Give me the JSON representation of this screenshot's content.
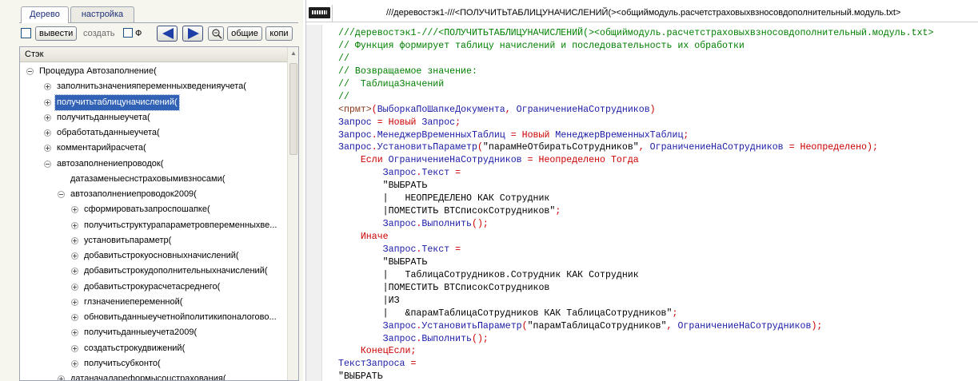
{
  "left": {
    "tabs": [
      "Дерево",
      "настройка"
    ],
    "toolbar": {
      "show_label": "вывести",
      "create_label": "создать",
      "f_label": "Ф",
      "common_label": "общие",
      "copy_label": "копи"
    },
    "tree_header": "Стэк",
    "tree_rows": [
      {
        "label": "Процедура Автозаполнение(",
        "level": 0,
        "expander": "minus",
        "selected": false
      },
      {
        "label": "заполнитьзначенияпеременныхведенияучета(",
        "level": 1,
        "expander": "plus",
        "selected": false
      },
      {
        "label": "получитьтаблицуначислений(",
        "level": 1,
        "expander": "plus",
        "selected": true
      },
      {
        "label": "получитьданныеучета(",
        "level": 1,
        "expander": "plus",
        "selected": false
      },
      {
        "label": "обработатьданныеучета(",
        "level": 1,
        "expander": "plus",
        "selected": false
      },
      {
        "label": "комментарийрасчета(",
        "level": 1,
        "expander": "plus",
        "selected": false
      },
      {
        "label": "автозаполнениепроводок(",
        "level": 1,
        "expander": "minus",
        "selected": false
      },
      {
        "label": "датазаменыеснстраховымивзносами(",
        "level": 2,
        "expander": "none",
        "selected": false
      },
      {
        "label": "автозаполнениепроводок2009(",
        "level": 2,
        "expander": "minus",
        "selected": false
      },
      {
        "label": "сформироватьзапроспошапке(",
        "level": 3,
        "expander": "plus",
        "selected": false
      },
      {
        "label": "получитьструктурапараметровпеременныхве...",
        "level": 3,
        "expander": "plus",
        "selected": false
      },
      {
        "label": "установитьпараметр(",
        "level": 3,
        "expander": "plus",
        "selected": false
      },
      {
        "label": "добавитьстрокуосновныхначислений(",
        "level": 3,
        "expander": "plus",
        "selected": false
      },
      {
        "label": "добавитьстрокудополнительныхначислений(",
        "level": 3,
        "expander": "plus",
        "selected": false
      },
      {
        "label": "добавитьстрокурасчетасреднего(",
        "level": 3,
        "expander": "plus",
        "selected": false
      },
      {
        "label": "глзначениепеременной(",
        "level": 3,
        "expander": "plus",
        "selected": false
      },
      {
        "label": "обновитьданныеучетнойполитикипоналогово...",
        "level": 3,
        "expander": "plus",
        "selected": false
      },
      {
        "label": "получитьданныеучета2009(",
        "level": 3,
        "expander": "plus",
        "selected": false
      },
      {
        "label": "создатьстрокудвижений(",
        "level": 3,
        "expander": "plus",
        "selected": false
      },
      {
        "label": "получитьсубконто(",
        "level": 3,
        "expander": "plus",
        "selected": false
      },
      {
        "label": "датаначалареформысоцстрахования(",
        "level": 2,
        "expander": "plus",
        "selected": false
      }
    ]
  },
  "right": {
    "title": "///деревостэк1-///<ПОЛУЧИТЬТАБЛИЦУНАЧИСЛЕНИЙ(><общиймодуль.расчетстраховыхвзносовдополнительный.модуль.txt>",
    "code_lines": [
      [
        {
          "t": "///деревостэк1-///<ПОЛУЧИТЬТАБЛИЦУНАЧИСЛЕНИЙ(><общиймодуль.расчетстраховыхвзносовдополнительный.модуль.txt>",
          "c": "com"
        }
      ],
      [
        {
          "t": "// Функция формирует таблицу начислений и последовательность их обработки",
          "c": "com"
        }
      ],
      [
        {
          "t": "//",
          "c": "com"
        }
      ],
      [
        {
          "t": "// Возвращаемое значение:",
          "c": "com"
        }
      ],
      [
        {
          "t": "//  ТаблицаЗначений",
          "c": "com"
        }
      ],
      [
        {
          "t": "//",
          "c": "com"
        }
      ],
      [
        {
          "t": "<прмт>",
          "c": "pp"
        },
        {
          "t": "(",
          "c": "op"
        },
        {
          "t": "ВыборкаПоШапкеДокумента",
          "c": "id"
        },
        {
          "t": ", ",
          "c": "op"
        },
        {
          "t": "ОграничениеНаСотрудников",
          "c": "id"
        },
        {
          "t": ")",
          "c": "op"
        }
      ],
      [
        {
          "t": "Запрос",
          "c": "id"
        },
        {
          "t": " = ",
          "c": "op"
        },
        {
          "t": "Новый",
          "c": "kw"
        },
        {
          "t": " Запрос",
          "c": "id"
        },
        {
          "t": ";",
          "c": "op"
        }
      ],
      [
        {
          "t": "Запрос",
          "c": "id"
        },
        {
          "t": ".",
          "c": "op"
        },
        {
          "t": "МенеджерВременныхТаблиц",
          "c": "id"
        },
        {
          "t": " = ",
          "c": "op"
        },
        {
          "t": "Новый",
          "c": "kw"
        },
        {
          "t": " МенеджерВременныхТаблиц",
          "c": "id"
        },
        {
          "t": ";",
          "c": "op"
        }
      ],
      [
        {
          "t": "Запрос",
          "c": "id"
        },
        {
          "t": ".",
          "c": "op"
        },
        {
          "t": "УстановитьПараметр",
          "c": "id"
        },
        {
          "t": "(",
          "c": "op"
        },
        {
          "t": "\"парамНеОтбиратьСотрудников\"",
          "c": "str"
        },
        {
          "t": ", ",
          "c": "op"
        },
        {
          "t": "ОграничениеНаСотрудников",
          "c": "id"
        },
        {
          "t": " = ",
          "c": "op"
        },
        {
          "t": "Неопределено",
          "c": "kw"
        },
        {
          "t": ");",
          "c": "op"
        }
      ],
      [
        {
          "t": "    "
        },
        {
          "t": "Если",
          "c": "kw"
        },
        {
          "t": " ОграничениеНаСотрудников",
          "c": "id"
        },
        {
          "t": " = ",
          "c": "op"
        },
        {
          "t": "Неопределено",
          "c": "kw"
        },
        {
          "t": " ",
          "c": "op"
        },
        {
          "t": "Тогда",
          "c": "kw"
        }
      ],
      [
        {
          "t": "        "
        },
        {
          "t": "Запрос",
          "c": "id"
        },
        {
          "t": ".",
          "c": "op"
        },
        {
          "t": "Текст",
          "c": "id"
        },
        {
          "t": " =",
          "c": "op"
        }
      ],
      [
        {
          "t": "        "
        },
        {
          "t": "\"ВЫБРАТЬ",
          "c": "str"
        }
      ],
      [
        {
          "t": "        "
        },
        {
          "t": "|   НЕОПРЕДЕЛЕНО КАК Сотрудник",
          "c": "str"
        }
      ],
      [
        {
          "t": "        "
        },
        {
          "t": "|ПОМЕСТИТЬ ВТСписокСотрудников\"",
          "c": "str"
        },
        {
          "t": ";",
          "c": "op"
        }
      ],
      [
        {
          "t": "        "
        },
        {
          "t": "Запрос",
          "c": "id"
        },
        {
          "t": ".",
          "c": "op"
        },
        {
          "t": "Выполнить",
          "c": "id"
        },
        {
          "t": "();",
          "c": "op"
        }
      ],
      [
        {
          "t": "    "
        },
        {
          "t": "Иначе",
          "c": "kw"
        }
      ],
      [
        {
          "t": "        "
        },
        {
          "t": "Запрос",
          "c": "id"
        },
        {
          "t": ".",
          "c": "op"
        },
        {
          "t": "Текст",
          "c": "id"
        },
        {
          "t": " =",
          "c": "op"
        }
      ],
      [
        {
          "t": "        "
        },
        {
          "t": "\"ВЫБРАТЬ",
          "c": "str"
        }
      ],
      [
        {
          "t": "        "
        },
        {
          "t": "|   ТаблицаСотрудников.Сотрудник КАК Сотрудник",
          "c": "str"
        }
      ],
      [
        {
          "t": "        "
        },
        {
          "t": "|ПОМЕСТИТЬ ВТСписокСотрудников",
          "c": "str"
        }
      ],
      [
        {
          "t": "        "
        },
        {
          "t": "|ИЗ",
          "c": "str"
        }
      ],
      [
        {
          "t": "        "
        },
        {
          "t": "|   &парамТаблицаСотрудников КАК ТаблицаСотрудников\"",
          "c": "str"
        },
        {
          "t": ";",
          "c": "op"
        }
      ],
      [
        {
          "t": "        "
        },
        {
          "t": "Запрос",
          "c": "id"
        },
        {
          "t": ".",
          "c": "op"
        },
        {
          "t": "УстановитьПараметр",
          "c": "id"
        },
        {
          "t": "(",
          "c": "op"
        },
        {
          "t": "\"парамТаблицаСотрудников\"",
          "c": "str"
        },
        {
          "t": ", ",
          "c": "op"
        },
        {
          "t": "ОграничениеНаСотрудников",
          "c": "id"
        },
        {
          "t": ");",
          "c": "op"
        }
      ],
      [
        {
          "t": "        "
        },
        {
          "t": "Запрос",
          "c": "id"
        },
        {
          "t": ".",
          "c": "op"
        },
        {
          "t": "Выполнить",
          "c": "id"
        },
        {
          "t": "();",
          "c": "op"
        }
      ],
      [
        {
          "t": "    "
        },
        {
          "t": "КонецЕсли",
          "c": "kw"
        },
        {
          "t": ";",
          "c": "op"
        }
      ],
      [
        {
          "t": "ТекстЗапроса",
          "c": "id"
        },
        {
          "t": " =",
          "c": "op"
        }
      ],
      [
        {
          "t": "\"ВЫБРАТЬ",
          "c": "str"
        }
      ]
    ]
  },
  "colors": {
    "selection": "#3162b6",
    "comment": "#008000",
    "keyword": "#cc0000",
    "identifier": "#1a1aa6",
    "nav_arrow": "#1f3fa8"
  },
  "icons": [
    "back-arrow-icon",
    "forward-arrow-icon",
    "zoom-icon",
    "doc-type-icon"
  ]
}
